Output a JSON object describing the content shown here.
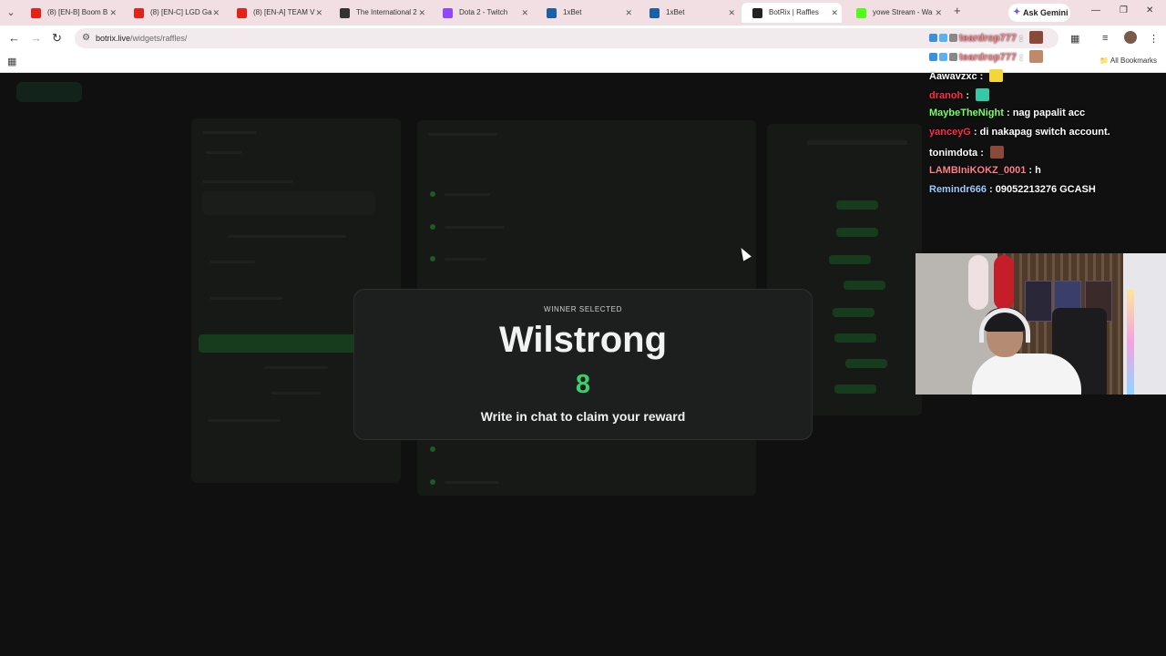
{
  "browser": {
    "tabs": [
      {
        "title": "(8) [EN-B] Boom B",
        "icon": "youtube-icon",
        "color": "#e62117"
      },
      {
        "title": "(8) [EN-C] LGD Ga",
        "icon": "youtube-icon",
        "color": "#e62117"
      },
      {
        "title": "(8) [EN-A] TEAM V",
        "icon": "youtube-icon",
        "color": "#e62117"
      },
      {
        "title": "The International 2",
        "icon": "github-icon",
        "color": "#333333"
      },
      {
        "title": "Dota 2 - Twitch",
        "icon": "twitch-icon",
        "color": "#9146ff"
      },
      {
        "title": "1xBet",
        "icon": "1xbet-icon",
        "color": "#1a5fa8"
      },
      {
        "title": "1xBet",
        "icon": "1xbet-icon",
        "color": "#1a5fa8"
      },
      {
        "title": "BotRix | Raffles",
        "icon": "botrix-icon",
        "color": "#222222"
      },
      {
        "title": "yowe Stream - Wa",
        "icon": "kick-icon",
        "color": "#53fc18"
      }
    ],
    "active_tab_index": 7,
    "ask_gemini": "Ask Gemini",
    "url_host": "botrix.live",
    "url_path": "/widgets/raffles/",
    "all_bookmarks": "All Bookmarks"
  },
  "modal": {
    "label": "WINNER SELECTED",
    "winner_name": "Wilstrong",
    "ticket_number": "8",
    "cta": "Write in chat to claim your reward",
    "accent_color": "#36d16b"
  },
  "chat": {
    "messages": [
      {
        "user": "teardrop777",
        "text": "",
        "color": "#ff7f8a",
        "badges": 3,
        "emote": true
      },
      {
        "user": "teardrop777",
        "text": "",
        "color": "#ff7f8a",
        "badges": 3,
        "emote": true
      },
      {
        "user": "Aawavzxc",
        "text": "",
        "color": "#ffffff",
        "badges": 0,
        "emote": true
      },
      {
        "user": "dranoh",
        "text": "",
        "color": "#ff2b4a",
        "badges": 0,
        "emote": true
      },
      {
        "user": "MaybeTheNight",
        "text": "nag papalit acc",
        "color": "#7cff63",
        "badges": 0,
        "emote": false
      },
      {
        "user": "yanceyG",
        "text": "di nakapag switch account.",
        "color": "#ff2b4a",
        "badges": 0,
        "emote": false
      },
      {
        "user": "tonimdota",
        "text": "",
        "color": "#ffffff",
        "badges": 0,
        "emote": true
      },
      {
        "user": "LAMBIniKOKZ_0001",
        "text": "h",
        "color": "#ff7f8a",
        "badges": 0,
        "emote": false
      },
      {
        "user": "Remindr666",
        "text": "09052213276 GCASH",
        "color": "#9ecbff",
        "badges": 0,
        "emote": false
      }
    ]
  }
}
